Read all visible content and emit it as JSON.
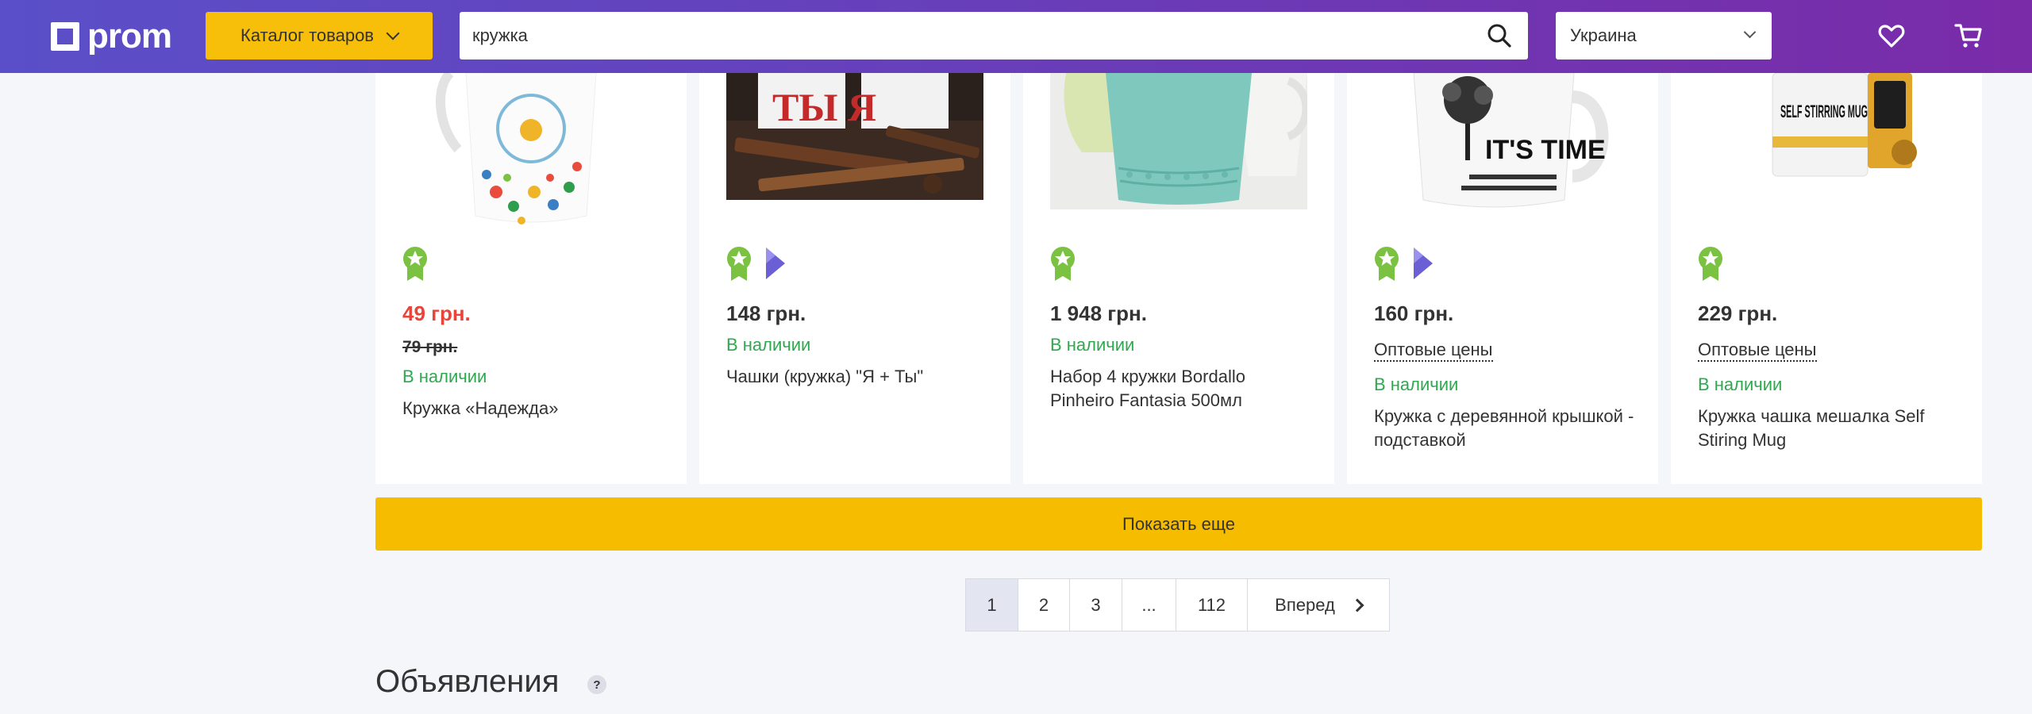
{
  "header": {
    "logo_text": "prom",
    "catalog_label": "Каталог товаров",
    "search_value": "кружка",
    "region_label": "Украина"
  },
  "colors": {
    "header_start": "#5a4fc8",
    "header_end": "#7a2ba8",
    "accent_yellow": "#f6bc00",
    "sale_red": "#e8443a",
    "in_stock_green": "#2fa84f"
  },
  "icons": {
    "logo": "prom-logo-icon",
    "search": "search-icon",
    "favorites": "heart-icon",
    "cart": "cart-icon",
    "top_seller": "award-icon",
    "prosale": "prosale-icon"
  },
  "products": [
    {
      "price": "49 грн.",
      "old_price": "79 грн.",
      "stock": "В наличии",
      "title": "Кружка «Надежда»"
    },
    {
      "price": "148 грн.",
      "stock": "В наличии",
      "title": "Чашки (кружка) \"Я + Ты\""
    },
    {
      "price": "1 948 грн.",
      "stock": "В наличии",
      "title": "Набор 4 кружки Bordallo Pinheiro Fantasia 500мл"
    },
    {
      "price": "160 грн.",
      "wholesale": "Оптовые цены",
      "stock": "В наличии",
      "title": "Кружка с деревянной крышкой - подставкой"
    },
    {
      "price": "229 грн.",
      "wholesale": "Оптовые цены",
      "stock": "В наличии",
      "title": "Кружка чашка мешалка Self Stiring Mug"
    }
  ],
  "product_images": {
    "p2_text": "ТЫ Я",
    "p4_text": "IT'S TIME",
    "p5_text": "SELF STIRRING MUG"
  },
  "show_more_label": "Показать еще",
  "pagination": {
    "pages": [
      "1",
      "2",
      "3",
      "...",
      "112"
    ],
    "current": "1",
    "next_label": "Вперед"
  },
  "ads": {
    "title": "Объявления",
    "help": "?"
  }
}
